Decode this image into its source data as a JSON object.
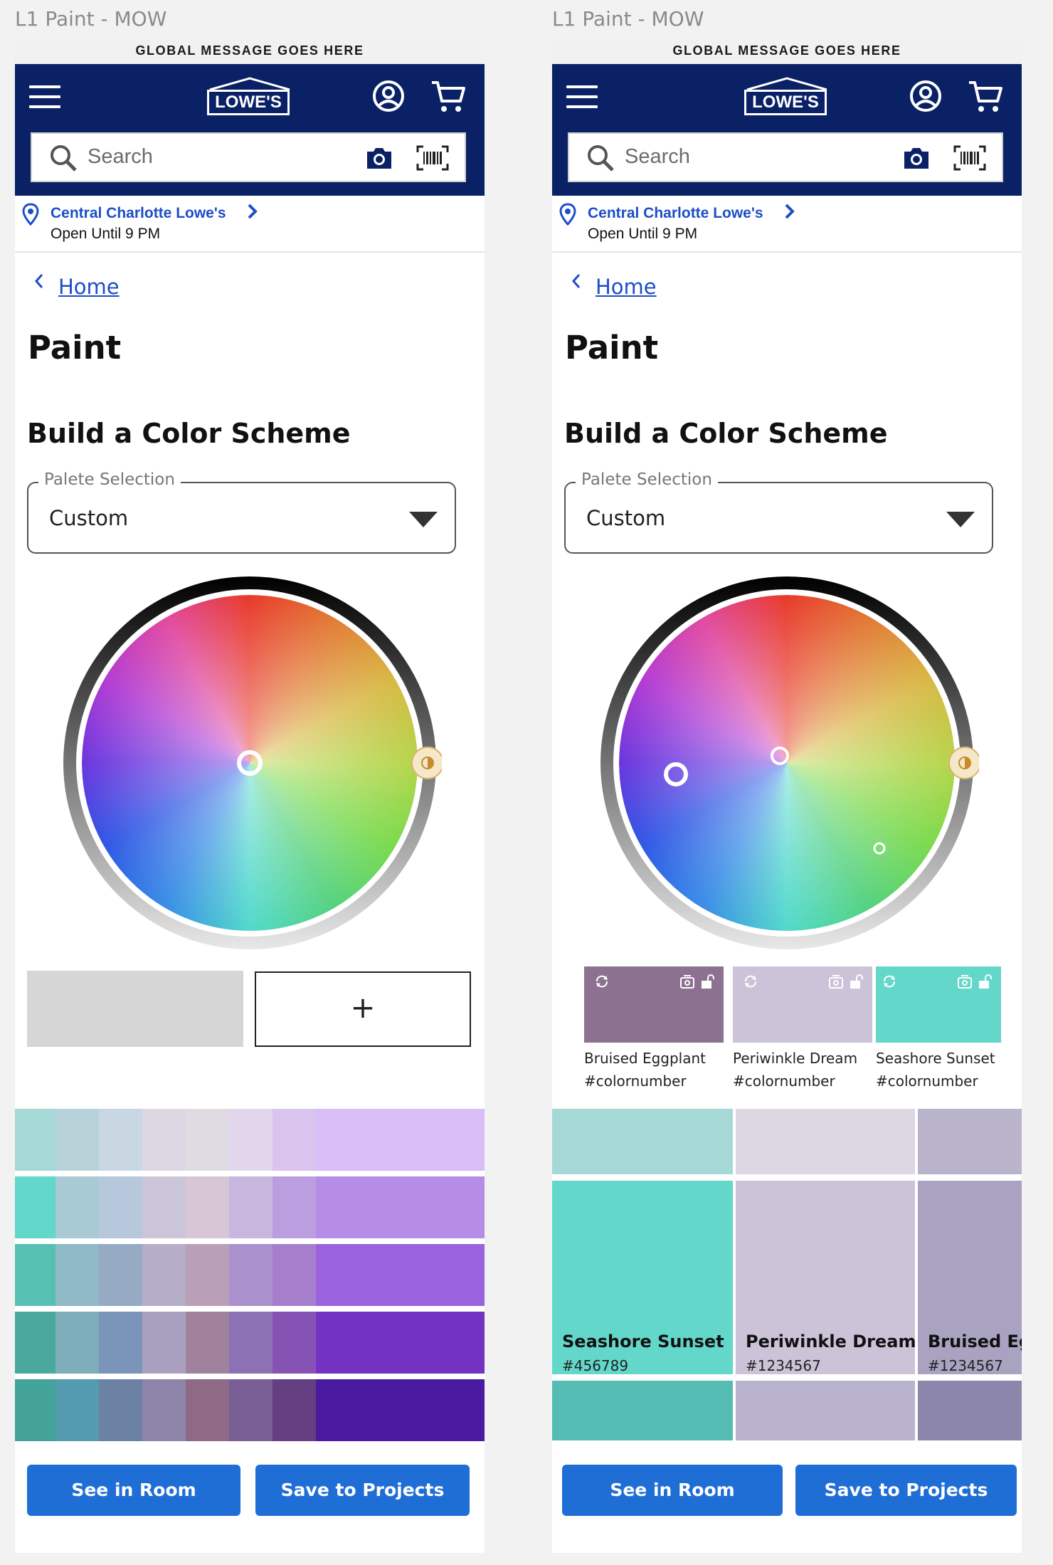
{
  "frames": [
    {
      "label": "L1 Paint - MOW",
      "global_message": "GLOBAL MESSAGE GOES HERE",
      "logo": "LOWE'S",
      "search_placeholder": "Search",
      "store_name": "Central Charlotte Lowe's",
      "store_hours": "Open Until 9 PM",
      "breadcrumb": "Home",
      "page_title": "Paint",
      "section_title": "Build a Color Scheme",
      "select_legend": "Palete Selection",
      "select_value": "Custom",
      "add_label": "+",
      "see_in_room": "See in Room",
      "save_to_projects": "Save to Projects"
    },
    {
      "label": "L1 Paint - MOW",
      "global_message": "GLOBAL MESSAGE GOES HERE",
      "logo": "LOWE'S",
      "search_placeholder": "Search",
      "store_name": "Central Charlotte Lowe's",
      "store_hours": "Open Until 9 PM",
      "breadcrumb": "Home",
      "page_title": "Paint",
      "section_title": "Build a Color Scheme",
      "select_legend": "Palete Selection",
      "select_value": "Custom",
      "chips": [
        {
          "name": "Bruised Eggplant",
          "hex": "#colornumber",
          "color": "#8c7290"
        },
        {
          "name": "Periwinkle Dream",
          "hex": "#colornumber",
          "color": "#ccc3d8"
        },
        {
          "name": "Seashore Sunset",
          "hex": "#colornumber",
          "color": "#63d7c9"
        }
      ],
      "swatch_cards": [
        {
          "name": "Seashore Sunset",
          "hex": "#456789",
          "color": "#63d7c9"
        },
        {
          "name": "Periwinkle Dream",
          "hex": "#1234567",
          "color": "#ccc3d8"
        },
        {
          "name": "Bruised Egg",
          "hex": "#1234567",
          "color": "#a9a3c1"
        }
      ],
      "see_in_room": "See in Room",
      "save_to_projects": "Save to Projects"
    }
  ],
  "colors": {
    "header_bg": "#0b2166",
    "link": "#1d4ec8",
    "button": "#1f6ed6"
  },
  "palette_grid": [
    [
      "#a6d8d6",
      "#b7d2d8",
      "#c8d7e2",
      "#dcd7e3",
      "#e0dbe3",
      "#e1d6ec",
      "#d8c4ec",
      "#d8bdf6"
    ],
    [
      "#63d7c9",
      "#a7cad5",
      "#b7c8dc",
      "#cbc5da",
      "#d7c6d6",
      "#c9b6de",
      "#bb9ee0",
      "#b58de6"
    ],
    [
      "#56c1b2",
      "#8fbac6",
      "#97aac4",
      "#b6adc8",
      "#b9a0b6",
      "#aa90cc",
      "#a57fcb",
      "#9b62e0"
    ],
    [
      "#4aa89d",
      "#7eadbb",
      "#7b94b9",
      "#a9a0c0",
      "#a0829d",
      "#8c72b4",
      "#8653b5",
      "#7432c3"
    ],
    [
      "#44a398",
      "#559bb0",
      "#6c82a5",
      "#8f85aa",
      "#8e6a86",
      "#7a5e96",
      "#663f83",
      "#4b1aa0"
    ]
  ]
}
